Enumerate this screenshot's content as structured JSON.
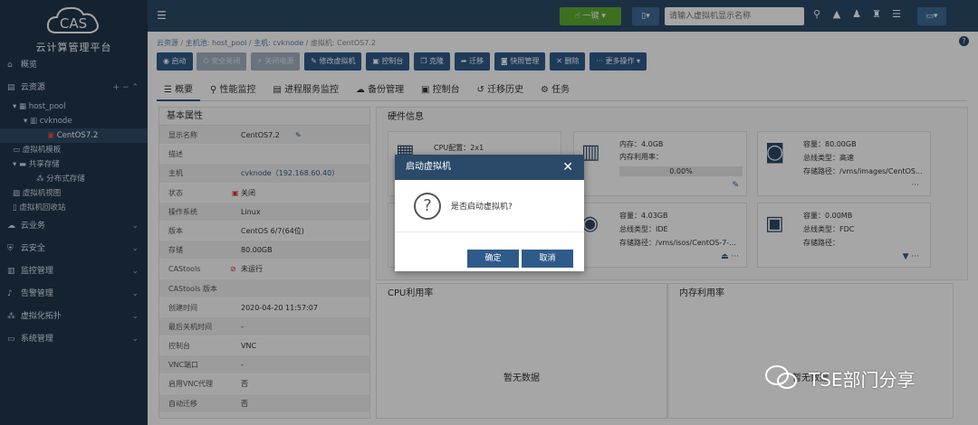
{
  "sidebar": {
    "brand": "CAS",
    "title": "云计算管理平台",
    "overview": "概览",
    "cloud_resources": "云资源",
    "host_pool": "host_pool",
    "cvknode": "cvknode",
    "vm": "CentOS7.2",
    "vm_template": "虚拟机模板",
    "shared_storage": "共享存储",
    "distributed_storage": "分布式存储",
    "vm_view": "虚拟机视图",
    "vm_recycle": "虚拟机回收站",
    "cloud_business": "云业务",
    "cloud_security": "云安全",
    "monitor": "监控管理",
    "alarm": "告警管理",
    "topology": "虚拟化拓扑",
    "system": "系统管理"
  },
  "topbar": {
    "one_key": "一键",
    "search_placeholder": "请输入虚拟机显示名称"
  },
  "breadcrumb": {
    "cloud": "云资源",
    "host_pool": "主机池: host_pool",
    "host": "主机: cvknode",
    "vm": "虚拟机: CentOS7.2"
  },
  "actions": [
    "启动",
    "安全关闭",
    "关闭电源",
    "修改虚拟机",
    "控制台",
    "克隆",
    "迁移",
    "快照管理",
    "删除",
    "更多操作"
  ],
  "tabs": [
    "概要",
    "性能监控",
    "进程服务监控",
    "备份管理",
    "控制台",
    "迁移历史",
    "任务"
  ],
  "basic": {
    "title": "基本属性",
    "rows": [
      {
        "k": "显示名称",
        "v": "CentOS7.2"
      },
      {
        "k": "描述",
        "v": ""
      },
      {
        "k": "主机",
        "v": "cvknode（192.168.60.40）"
      },
      {
        "k": "状态",
        "v": "关闭"
      },
      {
        "k": "操作系统",
        "v": "Linux"
      },
      {
        "k": "版本",
        "v": "CentOS 6/7(64位)"
      },
      {
        "k": "存储",
        "v": "80.00GB"
      },
      {
        "k": "CAStools",
        "v": "未运行"
      },
      {
        "k": "CAStools 版本",
        "v": ""
      },
      {
        "k": "创建时间",
        "v": "2020-04-20 11:57:07"
      },
      {
        "k": "最后关机时间",
        "v": "-"
      },
      {
        "k": "控制台",
        "v": "VNC"
      },
      {
        "k": "VNC端口",
        "v": "-"
      },
      {
        "k": "启用VNC代理",
        "v": "否"
      },
      {
        "k": "自动迁移",
        "v": "否"
      }
    ]
  },
  "hardware": {
    "title": "硬件信息",
    "cpu": "CPU配置：2x1",
    "memory": "内存：4.0GB",
    "memory_usage_label": "内存利用率：",
    "memory_usage": "0.00%",
    "memory_usage_fraction": 0.0,
    "disk_capacity": "容量：80.00GB",
    "disk_bus": "总线类型：高速",
    "disk_path": "存储路径：/vms/images/CentOS...",
    "cd_capacity": "容量：4.03GB",
    "cd_bus": "总线类型：IDE",
    "cd_path": "存储路径：/vms/isos/CentOS-7-...",
    "fd_capacity": "容量：0.00MB",
    "fd_bus": "总线类型：FDC",
    "fd_path": "存储路径："
  },
  "cpu_panel": {
    "title": "CPU利用率",
    "empty": "暂无数据"
  },
  "mem_panel": {
    "title": "内存利用率",
    "empty": "暂无数据"
  },
  "dialog": {
    "title": "启动虚拟机",
    "message": "是否启动虚拟机?",
    "ok": "确定",
    "cancel": "取消"
  },
  "watermark": "TSE部门分享",
  "colors": {
    "sidebar": "#21364c",
    "topbar": "#2b4a69",
    "primary": "#2e5b8a",
    "green": "#5cad32"
  }
}
